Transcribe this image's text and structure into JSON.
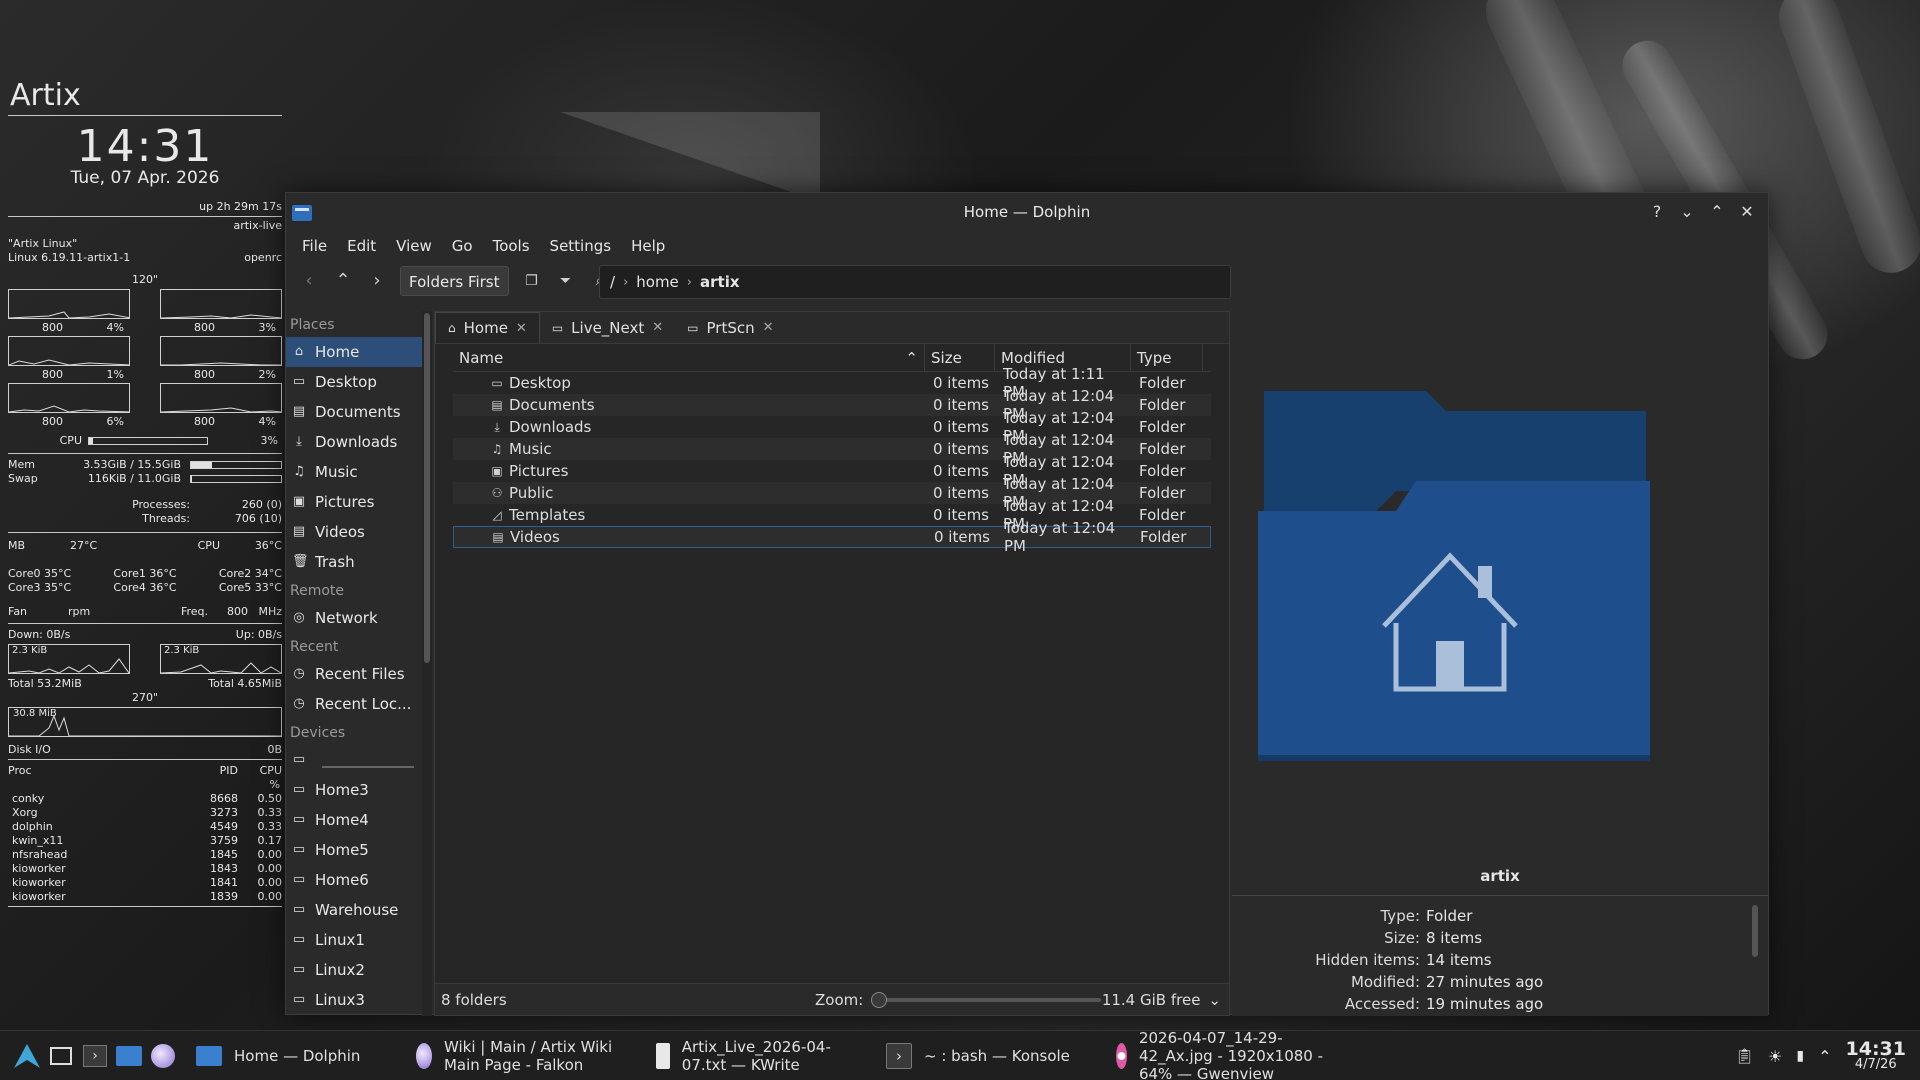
{
  "conky": {
    "title": "Artix",
    "time": "14:31",
    "date": "Tue, 07 Apr. 2026",
    "uptime": "up  2h 29m 17s",
    "host": "artix-live",
    "distro": "\"Artix Linux\"",
    "kernel": "Linux 6.19.11-artix1-1",
    "init": "openrc",
    "graph_label_top": "120\"",
    "cpu_graphs": [
      {
        "freq": "800",
        "pct": "4%"
      },
      {
        "freq": "800",
        "pct": "3%"
      },
      {
        "freq": "800",
        "pct": "1%"
      },
      {
        "freq": "800",
        "pct": "2%"
      },
      {
        "freq": "800",
        "pct": "6%"
      },
      {
        "freq": "800",
        "pct": "4%"
      }
    ],
    "cpu_label": "CPU",
    "cpu_pct": "3%",
    "cpu_fill": 0.03,
    "mem_label": "Mem",
    "mem_value": "3.53GiB / 15.5GiB",
    "mem_fill": 0.23,
    "swap_label": "Swap",
    "swap_value": "116KiB / 11.0GiB",
    "swap_fill": 0.01,
    "processes_label": "Processes:",
    "processes_value": "260 (0)",
    "threads_label": "Threads:",
    "threads_value": "706 (10)",
    "mb_label": "MB",
    "mb_temp": "27°C",
    "cpu_temp_label": "CPU",
    "cpu_temp": "36°C",
    "cores": [
      [
        "Core0 35°C",
        "Core1 36°C",
        "Core2 34°C"
      ],
      [
        "Core3 35°C",
        "Core4 36°C",
        "Core5 33°C"
      ]
    ],
    "fan_label": "Fan",
    "fan_unit": "rpm",
    "freq_label": "Freq.",
    "freq_value": "800",
    "freq_unit": "MHz",
    "down_label": "Down: 0B/s",
    "up_label": "Up: 0B/s",
    "down_graph_label": "2.3 KiB",
    "up_graph_label": "2.3 KiB",
    "total_down": "Total 53.2MiB",
    "total_up": "Total 4.65MiB",
    "graph_label_mid": "270\"",
    "disk_graph_label": "30.8 MiB",
    "disk_label": "Disk I/O",
    "disk_value": "0B",
    "proc_header": {
      "name": "Proc",
      "pid": "PID",
      "cpu": "CPU",
      "cpu_unit": "%"
    },
    "procs": [
      {
        "name": "conky",
        "pid": "8668",
        "cpu": "0.50"
      },
      {
        "name": "Xorg",
        "pid": "3273",
        "cpu": "0.33"
      },
      {
        "name": "dolphin",
        "pid": "4549",
        "cpu": "0.33"
      },
      {
        "name": "kwin_x11",
        "pid": "3759",
        "cpu": "0.17"
      },
      {
        "name": "nfsrahead",
        "pid": "1845",
        "cpu": "0.00"
      },
      {
        "name": "kioworker",
        "pid": "1843",
        "cpu": "0.00"
      },
      {
        "name": "kioworker",
        "pid": "1841",
        "cpu": "0.00"
      },
      {
        "name": "kioworker",
        "pid": "1839",
        "cpu": "0.00"
      }
    ]
  },
  "window": {
    "title": "Home — Dolphin",
    "menu": [
      "File",
      "Edit",
      "View",
      "Go",
      "Tools",
      "Settings",
      "Help"
    ],
    "folders_first": "Folders First",
    "breadcrumb": {
      "root": "/",
      "home": "home",
      "current": "artix"
    }
  },
  "places": {
    "sections": {
      "places": "Places",
      "remote": "Remote",
      "recent": "Recent",
      "devices": "Devices"
    },
    "items": [
      "Home",
      "Desktop",
      "Documents",
      "Downloads",
      "Music",
      "Pictures",
      "Videos",
      "Trash"
    ],
    "remote_items": [
      "Network"
    ],
    "recent_items": [
      "Recent Files",
      "Recent Loc..."
    ],
    "device_items": [
      "Home3",
      "Home4",
      "Home5",
      "Home6",
      "Warehouse",
      "Linux1",
      "Linux2",
      "Linux3"
    ]
  },
  "tabs": [
    "Home",
    "Live_Next",
    "PrtScn"
  ],
  "columns": {
    "name": "Name",
    "size": "Size",
    "modified": "Modified",
    "type": "Type"
  },
  "files": [
    {
      "name": "Desktop",
      "size": "0 items",
      "modified": "Today at 1:11 PM",
      "type": "Folder",
      "icon": "desktop-icon"
    },
    {
      "name": "Documents",
      "size": "0 items",
      "modified": "Today at 12:04 PM",
      "type": "Folder",
      "icon": "documents-icon"
    },
    {
      "name": "Downloads",
      "size": "0 items",
      "modified": "Today at 12:04 PM",
      "type": "Folder",
      "icon": "downloads-icon"
    },
    {
      "name": "Music",
      "size": "0 items",
      "modified": "Today at 12:04 PM",
      "type": "Folder",
      "icon": "music-icon"
    },
    {
      "name": "Pictures",
      "size": "0 items",
      "modified": "Today at 12:04 PM",
      "type": "Folder",
      "icon": "pictures-icon"
    },
    {
      "name": "Public",
      "size": "0 items",
      "modified": "Today at 12:04 PM",
      "type": "Folder",
      "icon": "public-icon"
    },
    {
      "name": "Templates",
      "size": "0 items",
      "modified": "Today at 12:04 PM",
      "type": "Folder",
      "icon": "templates-icon"
    },
    {
      "name": "Videos",
      "size": "0 items",
      "modified": "Today at 12:04 PM",
      "type": "Folder",
      "icon": "videos-icon"
    }
  ],
  "status": {
    "count": "8 folders",
    "zoom_label": "Zoom:",
    "free": "11.4 GiB free"
  },
  "info": {
    "name": "artix",
    "props": [
      {
        "k": "Type:",
        "v": "Folder"
      },
      {
        "k": "Size:",
        "v": "8 items"
      },
      {
        "k": "Hidden items:",
        "v": "14 items"
      },
      {
        "k": "Modified:",
        "v": "27 minutes ago"
      },
      {
        "k": "Accessed:",
        "v": "19 minutes ago"
      }
    ],
    "folder_color": "#1e4f8c"
  },
  "taskbar": {
    "tasks": [
      {
        "label": "Home — Dolphin"
      },
      {
        "label": "Wiki | Main / Artix Wiki Main Page - Falkon"
      },
      {
        "label": "Artix_Live_2026-04-07.txt — KWrite"
      },
      {
        "label": "~ : bash — Konsole"
      },
      {
        "label": "2026-04-07_14-29-42_Ax.jpg - 1920x1080 - 64% — Gwenview"
      }
    ],
    "clock_time": "14:31",
    "clock_date": "4/7/26"
  }
}
